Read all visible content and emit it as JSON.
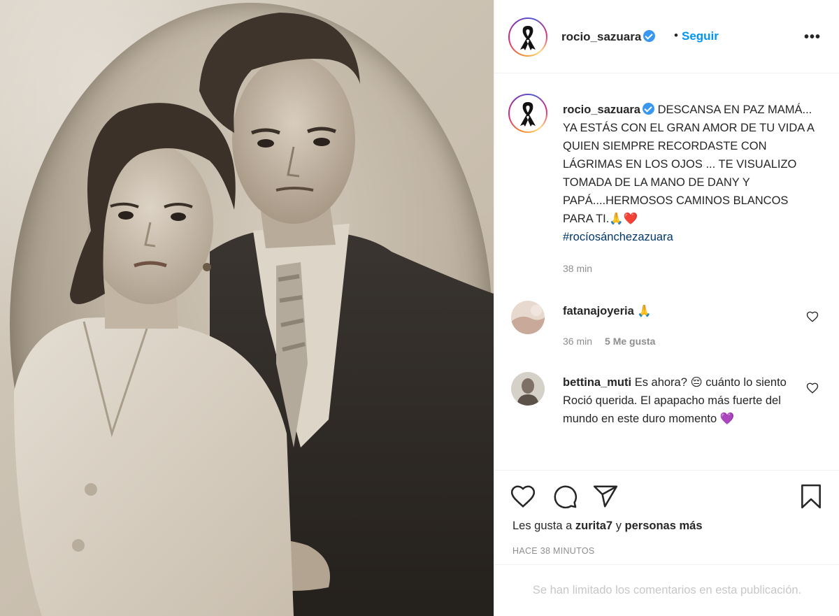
{
  "post": {
    "photo_alt": "Vintage sepia portrait of a young woman and a man in a suit"
  },
  "header": {
    "username": "rocio_sazuara",
    "dot": "•",
    "follow_label": "Seguir",
    "more_label": "•••",
    "avatar_icon": "black-ribbon-icon"
  },
  "caption": {
    "username": "rocio_sazuara",
    "text": "DESCANSA EN PAZ MAMÁ... YA ESTÁS CON EL GRAN AMOR DE TU VIDA A QUIEN SIEMPRE RECORDASTE CON LÁGRIMAS EN LOS OJOS ... TE VISUALIZO TOMADA DE LA MANO DE DANY Y PAPÁ....HERMOSOS CAMINOS BLANCOS PARA TI.",
    "emojis": "🙏❤️",
    "hashtag": "#rocíosánchezazuara",
    "time": "38 min"
  },
  "comments": [
    {
      "username": "fatanajoyeria",
      "text": "🙏",
      "time": "36 min",
      "likes": "5 Me gusta"
    },
    {
      "username": "bettina_muti",
      "text": "Es ahora? 😔 cuánto lo siento Roció querida. El apapacho más fuerte del mundo en este duro momento 💜"
    }
  ],
  "actions": {
    "like_icon": "heart-icon",
    "comment_icon": "comment-icon",
    "share_icon": "paper-plane-icon",
    "save_icon": "bookmark-icon",
    "likes_prefix": "Les gusta a",
    "likes_user": "zurita7",
    "likes_joiner": "y",
    "likes_suffix": "personas más",
    "timestamp": "HACE 38 MINUTOS"
  },
  "footer": {
    "limited_text": "Se han limitado los comentarios en esta publicación."
  },
  "colors": {
    "link": "#0095f6",
    "hashtag": "#00376b",
    "muted": "#8e8e8e",
    "verified": "#3897f0"
  }
}
